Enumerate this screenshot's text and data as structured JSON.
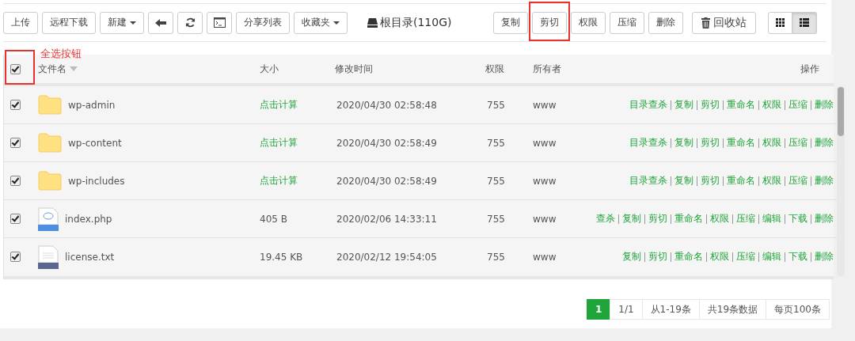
{
  "toolbar": {
    "left": [
      {
        "kind": "text",
        "label": "上传"
      },
      {
        "kind": "text",
        "label": "远程下载"
      },
      {
        "kind": "dropdown",
        "label": "新建"
      },
      {
        "kind": "icon"
      },
      {
        "kind": "icon"
      },
      {
        "kind": "icon"
      },
      {
        "kind": "text",
        "label": "分享列表"
      },
      {
        "kind": "dropdown",
        "label": "收藏夹"
      }
    ],
    "path": "根目录(110G)",
    "right": [
      {
        "label": "复制",
        "highlighted": false
      },
      {
        "label": "剪切",
        "highlighted": true
      },
      {
        "label": "权限",
        "highlighted": false
      },
      {
        "label": "压缩",
        "highlighted": false
      },
      {
        "label": "删除",
        "highlighted": false
      }
    ],
    "recycle": "回收站",
    "views": [
      {
        "selected": false
      },
      {
        "selected": true
      }
    ]
  },
  "annotation": "全选按钮",
  "table": {
    "select_all": {
      "checked": true,
      "highlighted": true
    },
    "columns": [
      "文件名",
      "大小",
      "修改时间",
      "权限",
      "所有者",
      "操作"
    ],
    "rows": [
      {
        "kind": "folder",
        "checked": true,
        "name": "wp-admin",
        "size": "点击计算",
        "size_link": true,
        "modified": "2020/04/30 02:58:48",
        "perm": "755",
        "owner": "www",
        "actions": [
          "目录查杀",
          "复制",
          "剪切",
          "重命名",
          "权限",
          "压缩",
          "删除"
        ]
      },
      {
        "kind": "folder",
        "checked": true,
        "name": "wp-content",
        "size": "点击计算",
        "size_link": true,
        "modified": "2020/04/30 02:58:49",
        "perm": "755",
        "owner": "www",
        "actions": [
          "目录查杀",
          "复制",
          "剪切",
          "重命名",
          "权限",
          "压缩",
          "删除"
        ]
      },
      {
        "kind": "folder",
        "checked": true,
        "name": "wp-includes",
        "size": "点击计算",
        "size_link": true,
        "modified": "2020/04/30 02:58:49",
        "perm": "755",
        "owner": "www",
        "actions": [
          "目录查杀",
          "复制",
          "剪切",
          "重命名",
          "权限",
          "压缩",
          "删除"
        ]
      },
      {
        "kind": "php",
        "checked": true,
        "name": "index.php",
        "size": "405 B",
        "size_link": false,
        "modified": "2020/02/06 14:33:11",
        "perm": "755",
        "owner": "www",
        "actions": [
          "查杀",
          "复制",
          "剪切",
          "重命名",
          "权限",
          "压缩",
          "编辑",
          "下载",
          "删除"
        ]
      },
      {
        "kind": "txt",
        "checked": true,
        "name": "license.txt",
        "size": "19.45 KB",
        "size_link": false,
        "modified": "2020/02/12 19:54:05",
        "perm": "755",
        "owner": "www",
        "actions": [
          "复制",
          "剪切",
          "重命名",
          "权限",
          "压缩",
          "编辑",
          "下载",
          "删除"
        ]
      }
    ]
  },
  "pagination": [
    {
      "label": "1",
      "selected": true
    },
    {
      "label": "1/1",
      "selected": false
    },
    {
      "label": "从1-19条",
      "selected": false
    },
    {
      "label": "共19条数据",
      "selected": false
    },
    {
      "label": "每页100条",
      "selected": false
    }
  ]
}
